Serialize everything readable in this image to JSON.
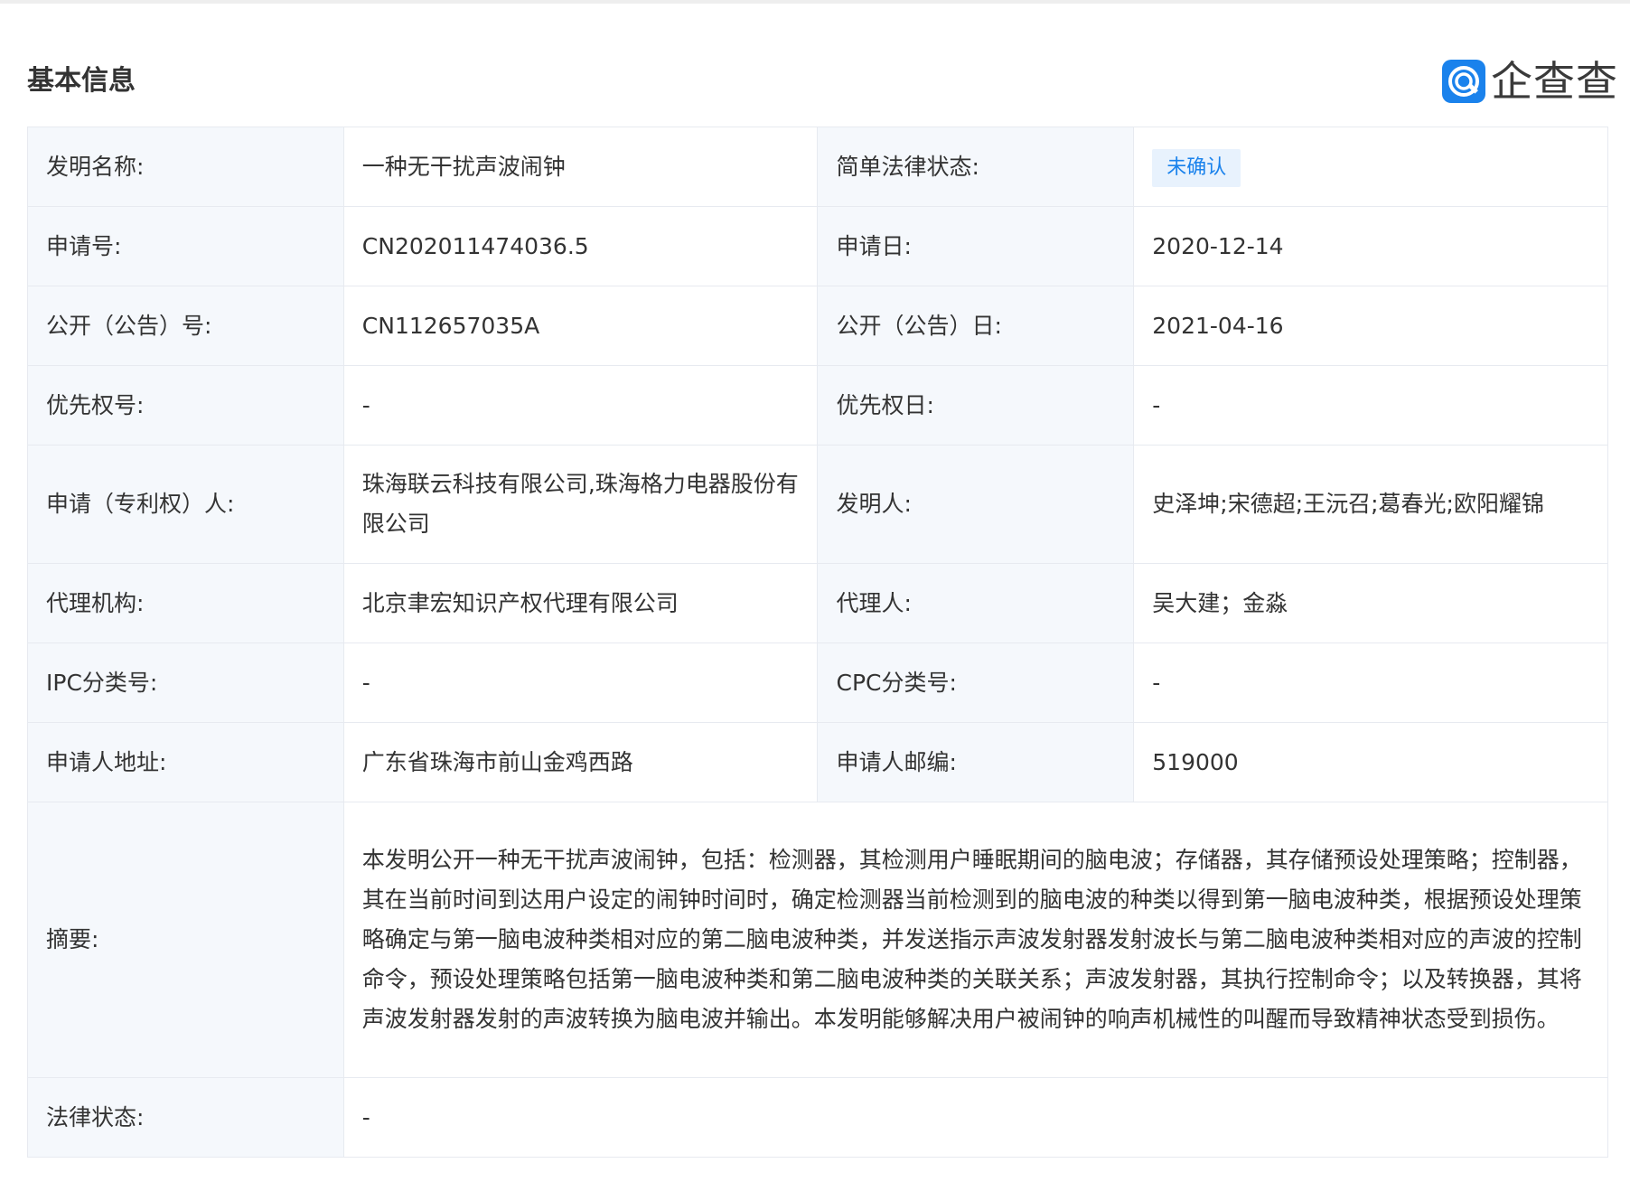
{
  "section": {
    "title": "基本信息"
  },
  "brand": {
    "name": "企查查",
    "icon": "qcc-logo-icon",
    "color": "#1a82ec"
  },
  "colors": {
    "label_bg": "#f5f8fc",
    "border": "#e7eaf0",
    "link": "#1a82ec",
    "badge_bg": "#e8f2fd"
  },
  "rows": [
    {
      "l1": "发明名称:",
      "v1": "一种无干扰声波闹钟",
      "l2": "简单法律状态:",
      "v2": "未确认"
    },
    {
      "l1": "申请号:",
      "v1": "CN202011474036.5",
      "l2": "申请日:",
      "v2": "2020-12-14"
    },
    {
      "l1": "公开（公告）号:",
      "v1": "CN112657035A",
      "l2": "公开（公告）日:",
      "v2": "2021-04-16"
    },
    {
      "l1": "优先权号:",
      "v1": "-",
      "l2": "优先权日:",
      "v2": "-"
    },
    {
      "l1": "申请（专利权）人:",
      "v1a": "珠海联云科技有限公司",
      "v1sep": ",",
      "v1b": "珠海格力电器股份有限公司",
      "l2": "发明人:",
      "v2": "史泽坤;宋德超;王沅召;葛春光;欧阳耀锦"
    },
    {
      "l1": "代理机构:",
      "v1": "北京聿宏知识产权代理有限公司",
      "l2": "代理人:",
      "v2": "吴大建；金淼"
    },
    {
      "l1": "IPC分类号:",
      "v1": "-",
      "l2": "CPC分类号:",
      "v2": "-"
    },
    {
      "l1": "申请人地址:",
      "v1": "广东省珠海市前山金鸡西路",
      "l2": "申请人邮编:",
      "v2": "519000"
    }
  ],
  "abstract": {
    "label": "摘要:",
    "text": "本发明公开一种无干扰声波闹钟，包括：检测器，其检测用户睡眠期间的脑电波；存储器，其存储预设处理策略；控制器，其在当前时间到达用户设定的闹钟时间时，确定检测器当前检测到的脑电波的种类以得到第一脑电波种类，根据预设处理策略确定与第一脑电波种类相对应的第二脑电波种类，并发送指示声波发射器发射波长与第二脑电波种类相对应的声波的控制命令，预设处理策略包括第一脑电波种类和第二脑电波种类的关联关系；声波发射器，其执行控制命令；以及转换器，其将声波发射器发射的声波转换为脑电波并输出。本发明能够解决用户被闹钟的响声机械性的叫醒而导致精神状态受到损伤。"
  },
  "legal_status": {
    "label": "法律状态:",
    "value": "-"
  }
}
